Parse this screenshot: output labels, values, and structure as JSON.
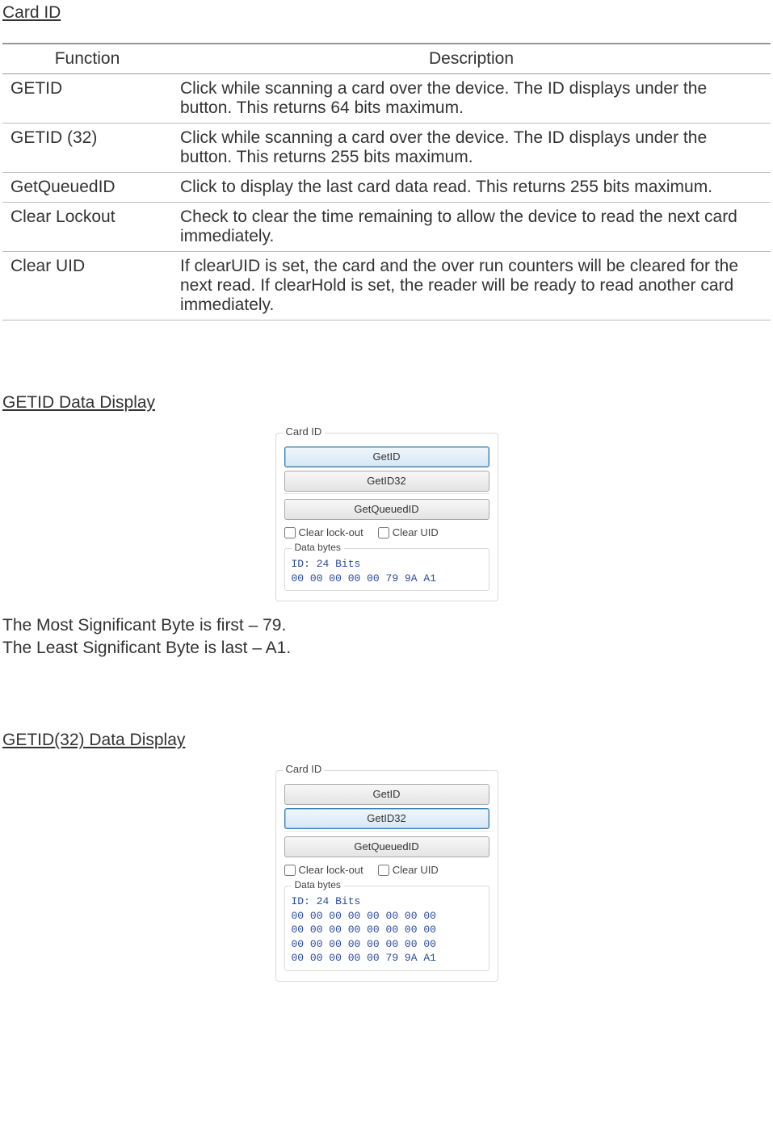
{
  "titles": {
    "card_id": "Card ID",
    "getid_display": "GETID Data Display",
    "getid32_display": "GETID(32) Data Display"
  },
  "table": {
    "headers": {
      "fn": "Function",
      "desc": "Description"
    },
    "rows": [
      {
        "fn": "GETID",
        "desc": "Click while scanning a card over the device. The ID displays under the button. This returns 64 bits maximum."
      },
      {
        "fn": "GETID (32)",
        "desc": "Click while scanning a card over the device. The ID displays under the button. This returns 255 bits maximum."
      },
      {
        "fn": "GetQueuedID",
        "desc": "Click to display the last card data read. This returns 255 bits maximum."
      },
      {
        "fn": "Clear Lockout",
        "desc": "Check to clear the time remaining to allow the device to read the next card immediately."
      },
      {
        "fn": "Clear UID",
        "desc": "If clearUID is set, the card and the over run counters will be cleared for the next read.\nIf clearHold is set, the reader will be ready to read another card immediately."
      }
    ]
  },
  "panel_common": {
    "group_title": "Card ID",
    "btn_getid": "GetID",
    "btn_getid32": "GetID32",
    "btn_getqueued": "GetQueuedID",
    "chk_clear_lockout": "Clear lock-out",
    "chk_clear_uid": "Clear UID",
    "data_bytes_title": "Data bytes"
  },
  "panel1": {
    "active": "getid",
    "mono": "ID: 24 Bits\n00 00 00 00 00 79 9A A1"
  },
  "panel2": {
    "active": "getid32",
    "mono": "ID: 24 Bits\n00 00 00 00 00 00 00 00\n00 00 00 00 00 00 00 00\n00 00 00 00 00 00 00 00\n00 00 00 00 00 79 9A A1"
  },
  "body": {
    "msb": "The Most Significant Byte is first – 79.",
    "lsb": "The Least Significant Byte is last – A1."
  }
}
